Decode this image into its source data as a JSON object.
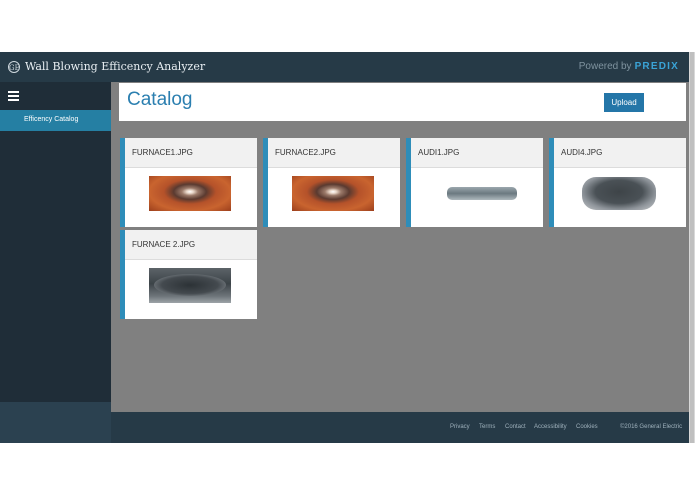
{
  "topbar": {
    "logo_text": "GE",
    "app_title": "Wall Blowing Efficency Analyzer",
    "powered_prefix": "Powered by",
    "powered_brand": "PREDIX"
  },
  "sidebar": {
    "items": [
      {
        "label": "Efficency Catalog",
        "active": true
      }
    ]
  },
  "main": {
    "page_title": "Catalog",
    "upload_label": "Upload",
    "cards": [
      {
        "title": "FURNACE1.JPG",
        "thumbnail": "furnace-photo"
      },
      {
        "title": "FURNACE2.JPG",
        "thumbnail": "furnace-photo"
      },
      {
        "title": "AUDI1.JPG",
        "thumbnail": "tank-photo"
      },
      {
        "title": "AUDI4.JPG",
        "thumbnail": "duct-photo"
      },
      {
        "title": "FURNACE 2.JPG",
        "thumbnail": "pipe-photo"
      }
    ]
  },
  "footer": {
    "links": [
      "Privacy",
      "Terms",
      "Contact",
      "Accessibility",
      "Cookies"
    ],
    "copyright": "©2016 General Electric"
  },
  "colors": {
    "topbar": "#263a47",
    "sidebar": "#1f2d38",
    "accent": "#2e8db9",
    "content_bg": "#808080",
    "brand": "#3aa3d6"
  }
}
